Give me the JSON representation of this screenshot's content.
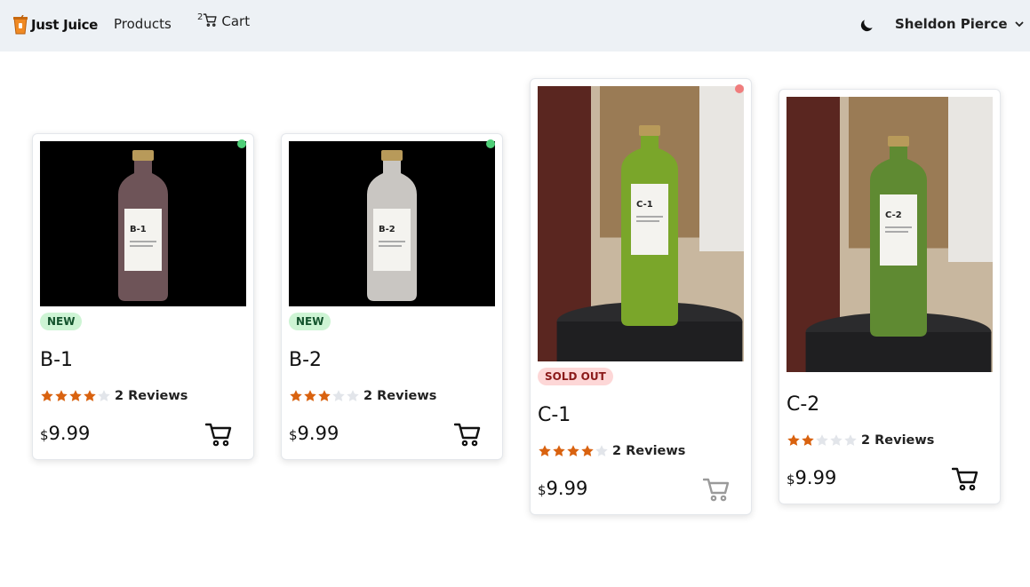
{
  "nav": {
    "brand": "Just Juice",
    "products_label": "Products",
    "cart_count": "2",
    "cart_label": "Cart",
    "user_name": "Sheldon Pierce"
  },
  "colors": {
    "navbar_bg": "#edf1f5",
    "star_filled": "#d9620f",
    "star_empty": "#e2e5ea",
    "available_dot": "#4fcf78",
    "soldout_dot": "#f07d7d",
    "new_badge_bg": "#cdf4d4",
    "soldout_badge_bg": "#fdd7d7"
  },
  "products": [
    {
      "name": "B-1",
      "badge": "NEW",
      "rating": 4,
      "reviews": "2 Reviews",
      "currency": "$",
      "price": "9.99",
      "status": "available",
      "juice": "purple",
      "photo_bg": "black",
      "label": "B-1",
      "cart_enabled": true
    },
    {
      "name": "B-2",
      "badge": "NEW",
      "rating": 3,
      "reviews": "2 Reviews",
      "currency": "$",
      "price": "9.99",
      "status": "available",
      "juice": "milky",
      "photo_bg": "black",
      "label": "B-2",
      "cart_enabled": true
    },
    {
      "name": "C-1",
      "badge": "SOLD OUT",
      "rating": 4,
      "reviews": "2 Reviews",
      "currency": "$",
      "price": "9.99",
      "status": "sold-out",
      "juice": "green",
      "photo_bg": "shop",
      "label": "C-1",
      "cart_enabled": false
    },
    {
      "name": "C-2",
      "badge": "",
      "rating": 2,
      "reviews": "2 Reviews",
      "currency": "$",
      "price": "9.99",
      "status": "available",
      "juice": "dark-green",
      "photo_bg": "shop",
      "label": "C-2",
      "cart_enabled": true
    }
  ]
}
